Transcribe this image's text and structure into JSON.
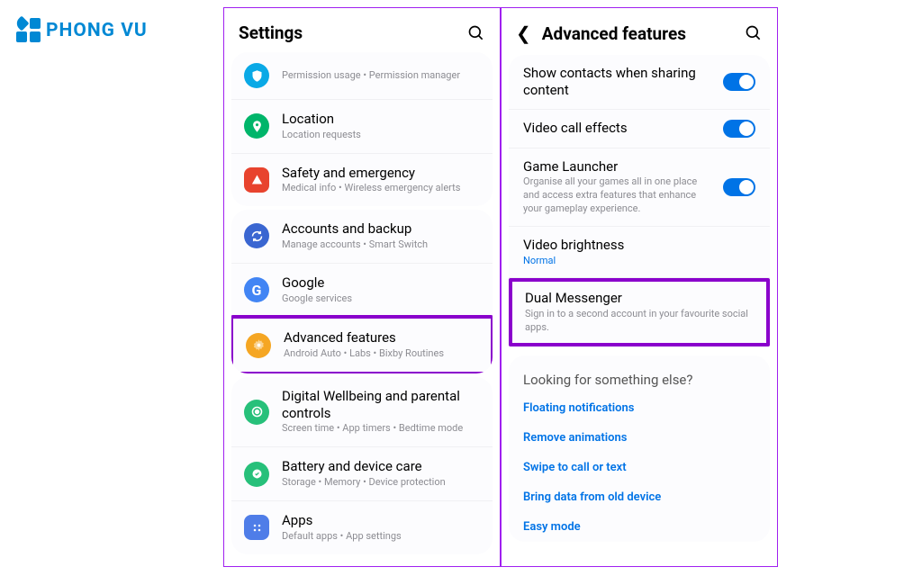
{
  "logo": {
    "text": "PHONG VU"
  },
  "left": {
    "title": "Settings",
    "g1": {
      "privacy": {
        "title": "",
        "sub": "Permission usage  •  Permission manager",
        "color": "#0aa9e6"
      },
      "location": {
        "title": "Location",
        "sub": "Location requests",
        "color": "#00b56a"
      },
      "safety": {
        "title": "Safety and emergency",
        "sub": "Medical info  •  Wireless emergency alerts",
        "color": "#e8432e"
      }
    },
    "g2": {
      "accounts": {
        "title": "Accounts and backup",
        "sub": "Manage accounts  •  Smart Switch",
        "color": "#3a66d1"
      },
      "google": {
        "title": "Google",
        "sub": "Google services",
        "color": "#4285f4",
        "letter": "G"
      },
      "advanced": {
        "title": "Advanced features",
        "sub": "Android Auto  •  Labs  •  Bixby Routines",
        "color": "#f5a623"
      }
    },
    "g3": {
      "wellbeing": {
        "title": "Digital Wellbeing and parental controls",
        "sub": "Screen time  •  App timers  •  Bedtime mode",
        "color": "#27c07a"
      },
      "battery": {
        "title": "Battery and device care",
        "sub": "Storage  •  Memory  •  Device protection",
        "color": "#27c07a"
      },
      "apps": {
        "title": "Apps",
        "sub": "Default apps  •  App settings",
        "color": "#4f7de8"
      }
    }
  },
  "right": {
    "title": "Advanced features",
    "g1": {
      "contacts": {
        "title": "Show contacts when sharing content",
        "on": true
      },
      "videocall": {
        "title": "Video call effects",
        "on": true
      },
      "launcher": {
        "title": "Game Launcher",
        "sub": "Organise all your games all in one place and access extra features that enhance your gameplay experience.",
        "on": true
      },
      "brightness": {
        "title": "Video brightness",
        "sub": "Normal"
      },
      "dual": {
        "title": "Dual Messenger",
        "sub": "Sign in to a second account in your favourite social apps."
      }
    },
    "suggest": {
      "title": "Looking for something else?",
      "links": {
        "a": "Floating notifications",
        "b": "Remove animations",
        "c": "Swipe to call or text",
        "d": "Bring data from old device",
        "e": "Easy mode"
      }
    }
  }
}
